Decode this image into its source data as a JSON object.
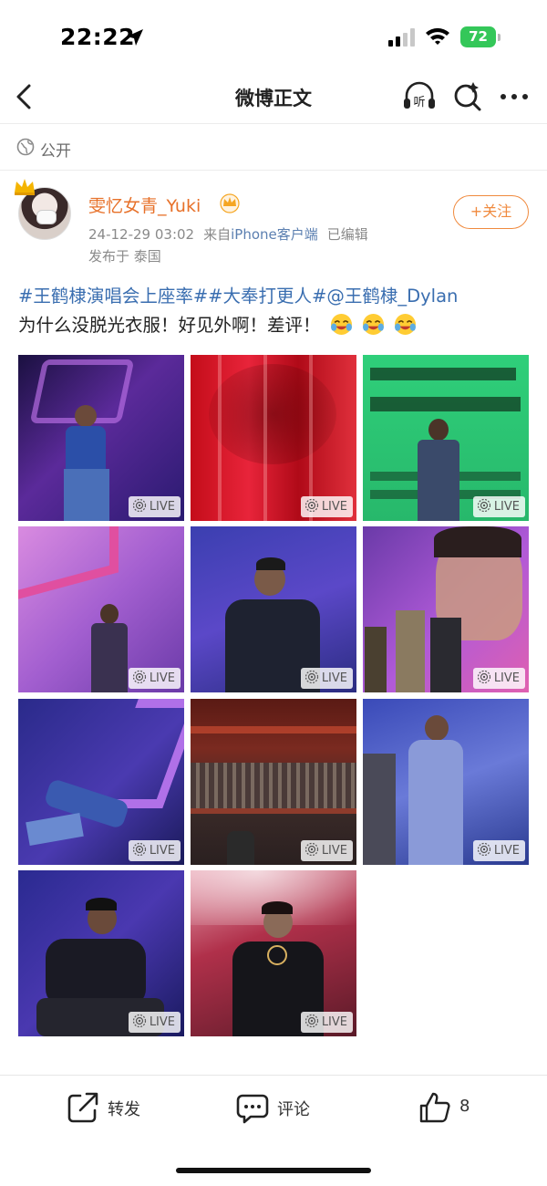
{
  "status_bar": {
    "time": "22:22",
    "battery": "72",
    "icons": [
      "location-arrow-icon",
      "signal-icon",
      "wifi-icon",
      "battery-icon"
    ]
  },
  "nav": {
    "title": "微博正文",
    "icons": [
      "back-icon",
      "listen-icon",
      "search-icon",
      "more-icon"
    ],
    "listen_glyph": "听"
  },
  "visibility": {
    "label": "公开",
    "icon": "globe-icon"
  },
  "post": {
    "username": "雯忆女青_Yuki",
    "date": "24-12-29 03:02",
    "source_prefix": "来自",
    "device": "iPhone客户端",
    "edited": "已编辑",
    "location": "发布于 泰国",
    "follow_label": "+关注",
    "line1": "#王鹤棣演唱会上座率##大奉打更人#@王鹤棣_Dylan",
    "line2": "为什么没脱光衣服！好见外啊！差评！",
    "emoji_count": 3,
    "image_badge": "LIVE",
    "image_count": 11
  },
  "colors": {
    "accent_orange": "#e7712a",
    "link_blue": "#3a6eb0",
    "battery_green": "#34c759"
  },
  "actions": {
    "repost_label": "转发",
    "comment_label": "评论",
    "like_count": "8"
  }
}
